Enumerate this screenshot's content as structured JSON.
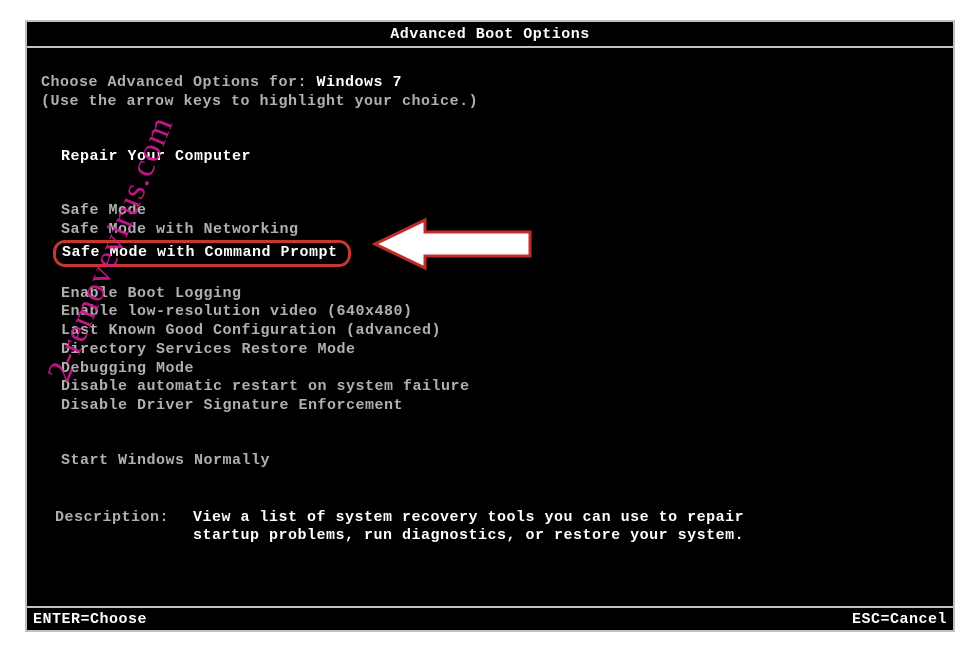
{
  "title": "Advanced Boot Options",
  "prompt_prefix": "Choose Advanced Options for: ",
  "os_name": "Windows 7",
  "hint": "(Use the arrow keys to highlight your choice.)",
  "groups": {
    "repair": "Repair Your Computer",
    "safe": [
      "Safe Mode",
      "Safe Mode with Networking",
      "Safe Mode with Command Prompt"
    ],
    "extras": [
      "Enable Boot Logging",
      "Enable low-resolution video (640x480)",
      "Last Known Good Configuration (advanced)",
      "Directory Services Restore Mode",
      "Debugging Mode",
      "Disable automatic restart on system failure",
      "Disable Driver Signature Enforcement"
    ],
    "normal": "Start Windows Normally"
  },
  "highlighted_index": 2,
  "description_label": "Description:",
  "description_text": "View a list of system recovery tools you can use to repair startup problems, run diagnostics, or restore your system.",
  "footer": {
    "enter": "ENTER=Choose",
    "esc": "ESC=Cancel"
  },
  "watermark": "2-removevirus.com",
  "colors": {
    "highlight_border": "#c8362f",
    "watermark": "#d11890",
    "text_bright": "#ffffff",
    "text_dim": "#b0b0b0",
    "bg": "#000000"
  }
}
